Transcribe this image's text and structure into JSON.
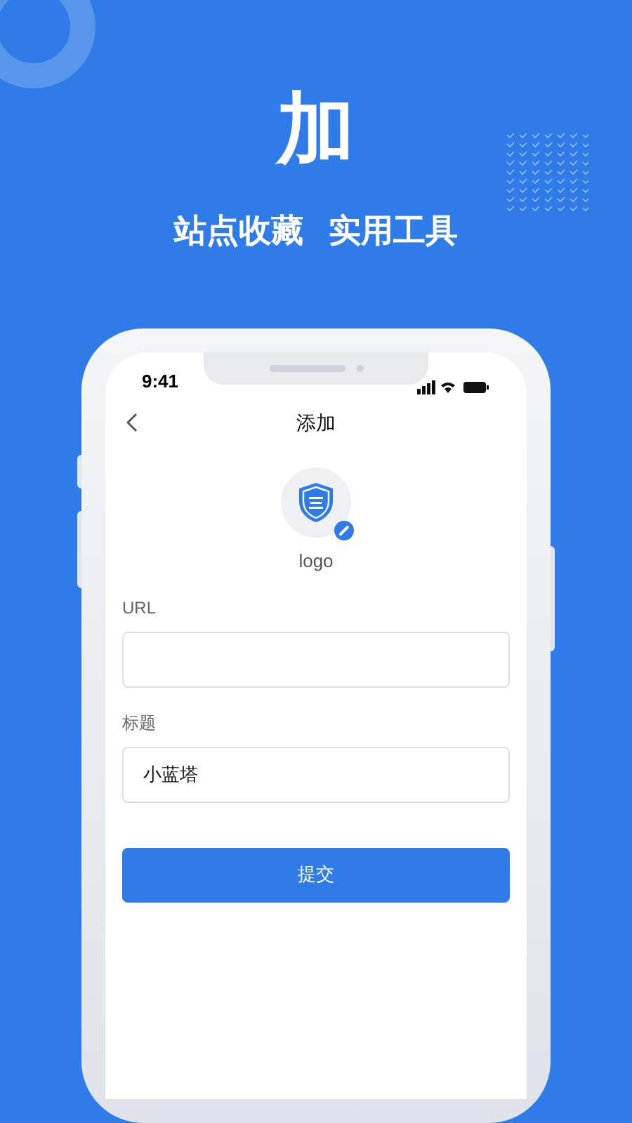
{
  "headline": "加",
  "taglines": [
    "站点收藏",
    "实用工具"
  ],
  "status_bar": {
    "time": "9:41"
  },
  "nav": {
    "title": "添加"
  },
  "logo": {
    "label": "logo"
  },
  "fields": [
    {
      "label": "URL"
    },
    {
      "label": "标题",
      "value": "小蓝塔"
    }
  ],
  "submit": {
    "label": "提交"
  }
}
